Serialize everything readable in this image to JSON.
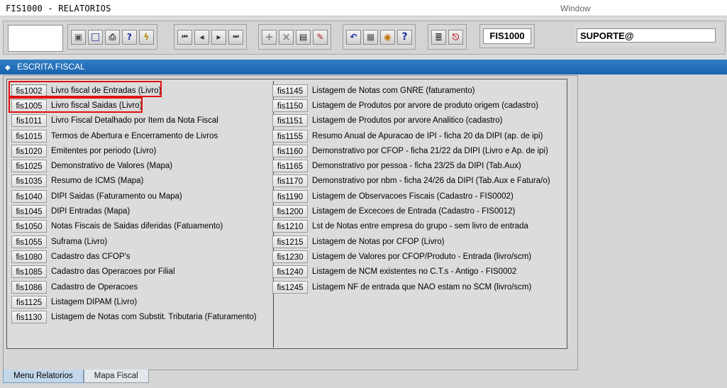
{
  "app": {
    "title": "FIS1000 - RELATORIOS",
    "window_menu": "Window"
  },
  "toolbar": {
    "form_name": "FIS1000",
    "user": "SUPORTE@",
    "groups": [
      [
        "save-icon",
        "window-icon",
        "print-icon",
        "enter-query-icon",
        "execute-query-icon"
      ],
      [
        "first-record-icon",
        "previous-record-icon",
        "next-record-icon",
        "last-record-icon"
      ],
      [
        "insert-record-icon",
        "delete-record-icon",
        "duplicate-record-icon",
        "clear-record-icon"
      ],
      [
        "undo-icon",
        "clipboard-icon",
        "find-icon",
        "help-icon"
      ],
      [
        "menu-icon",
        "exit-icon"
      ]
    ]
  },
  "section": {
    "title": "ESCRITA FISCAL"
  },
  "reports_left": [
    {
      "code": "fis1002",
      "label": "Livro fiscal de Entradas (Livro)"
    },
    {
      "code": "fis1005",
      "label": "Livro fiscal Saidas (Livro)"
    },
    {
      "code": "fis1011",
      "label": "Livro Fiscal Detalhado por Item da Nota Fiscal"
    },
    {
      "code": "fis1015",
      "label": "Termos de Abertura e  Encerramento de Livros"
    },
    {
      "code": "fis1020",
      "label": "Emitentes por periodo (Livro)"
    },
    {
      "code": "fis1025",
      "label": "Demonstrativo de Valores (Mapa)"
    },
    {
      "code": "fis1035",
      "label": "Resumo de ICMS (Mapa)"
    },
    {
      "code": "fis1040",
      "label": "DIPI Saidas (Faturamento ou Mapa)"
    },
    {
      "code": "fis1045",
      "label": "DIPI Entradas (Mapa)"
    },
    {
      "code": "fis1050",
      "label": "Notas Fiscais de Saidas diferidas (Fatuamento)"
    },
    {
      "code": "fis1055",
      "label": "Suframa (Livro)"
    },
    {
      "code": "fis1080",
      "label": "Cadastro das CFOP's"
    },
    {
      "code": "fis1085",
      "label": "Cadastro das Operacoes por Filial"
    },
    {
      "code": "fis1086",
      "label": "Cadastro de Operacoes"
    },
    {
      "code": "fis1125",
      "label": "Listagem DIPAM (Livro)"
    },
    {
      "code": "fis1130",
      "label": "Listagem de Notas com Substit. Tributaria (Faturamento)"
    }
  ],
  "reports_right": [
    {
      "code": "fis1145",
      "label": "Listagem de Notas com GNRE (faturamento)"
    },
    {
      "code": "fis1150",
      "label": "Listagem de Produtos por arvore de produto origem (cadastro)"
    },
    {
      "code": "fis1151",
      "label": "Listagem de Produtos por arvore Analitico (cadastro)"
    },
    {
      "code": "fis1155",
      "label": "Resumo Anual de Apuracao de IPI - ficha 20 da DIPI  (ap. de ipi)"
    },
    {
      "code": "fis1160",
      "label": "Demonstrativo por CFOP - ficha 21/22 da DIPI  (Livro e Ap. de ipi)"
    },
    {
      "code": "fis1165",
      "label": "Demonstrativo por pessoa - ficha 23/25 da DIPI  (Tab.Aux)"
    },
    {
      "code": "fis1170",
      "label": "Demonstrativo por nbm - ficha 24/26 da DIPI  (Tab.Aux e Fatura/o)"
    },
    {
      "code": "fis1190",
      "label": "Listagem de Observacoes Fiscais  (Cadastro - FIS0002)"
    },
    {
      "code": "fis1200",
      "label": "Listagem de Excecoes de Entrada  (Cadastro - FIS0012)"
    },
    {
      "code": "fis1210",
      "label": "Lst de Notas entre empresa do grupo - sem  livro de entrada"
    },
    {
      "code": "fis1215",
      "label": "Listagem de Notas por CFOP (Livro)"
    },
    {
      "code": "fis1230",
      "label": "Listagem de Valores por CFOP/Produto - Entrada  (livro/scm)"
    },
    {
      "code": "fis1240",
      "label": "Listagem de NCM existentes no C.T.s - Antigo - FIS0002"
    },
    {
      "code": "fis1245",
      "label": "Listagem  NF de entrada que NAO estam no SCM (livro/scm)"
    }
  ],
  "tabs": [
    {
      "label": "Menu Relatorios",
      "active": true
    },
    {
      "label": "Mapa Fiscal",
      "active": false
    }
  ],
  "colors": {
    "section_bar": "#1f68b2",
    "highlight": "#e01010",
    "active_tab": "#c3d7ea"
  }
}
